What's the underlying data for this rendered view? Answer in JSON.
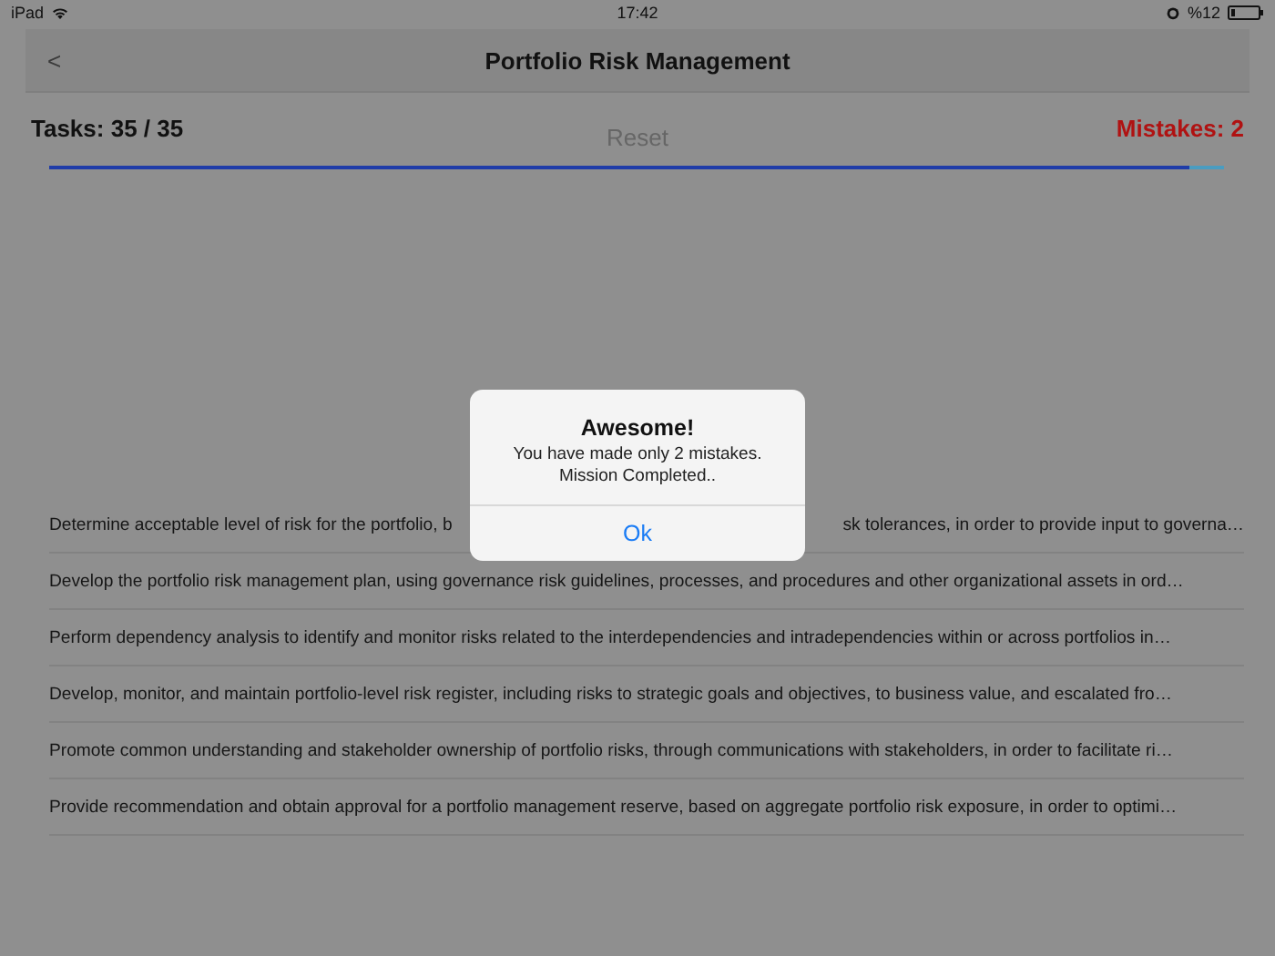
{
  "status_bar": {
    "device": "iPad",
    "time": "17:42",
    "battery": "%12"
  },
  "nav_bar": {
    "back": "<",
    "title": "Portfolio Risk Management"
  },
  "summary": {
    "tasks": "Tasks: 35 / 35",
    "reset": "Reset",
    "mistakes": "Mistakes: 2"
  },
  "progress": {
    "level": 0.97
  },
  "tasks": [
    {
      "segments": [
        "Determine acceptable level of risk for the portfolio, b",
        "sk tolerances, in order to provide input to governa…"
      ]
    },
    {
      "segments": [
        "Develop the portfolio risk management plan, using governance risk guidelines, processes, and procedures and other organizational assets in ord…"
      ]
    },
    {
      "segments": [
        "Perform dependency analysis to identify and monitor risks related to the interdependencies and intradependencies within or across portfolios in…"
      ]
    },
    {
      "segments": [
        "Develop, monitor, and maintain portfolio-level risk register, including risks to strategic goals and objectives, to business value, and escalated fro…"
      ]
    },
    {
      "segments": [
        "Promote common understanding and stakeholder ownership of portfolio risks, through communications with stakeholders, in order to facilitate ri…"
      ]
    },
    {
      "segments": [
        "Provide recommendation and obtain approval for a portfolio management reserve, based on aggregate portfolio risk exposure, in order to optimi…"
      ]
    }
  ],
  "alert": {
    "title": "Awesome!",
    "message": [
      "You have made only 2 mistakes.",
      "Mission Completed.."
    ],
    "button": "Ok"
  }
}
